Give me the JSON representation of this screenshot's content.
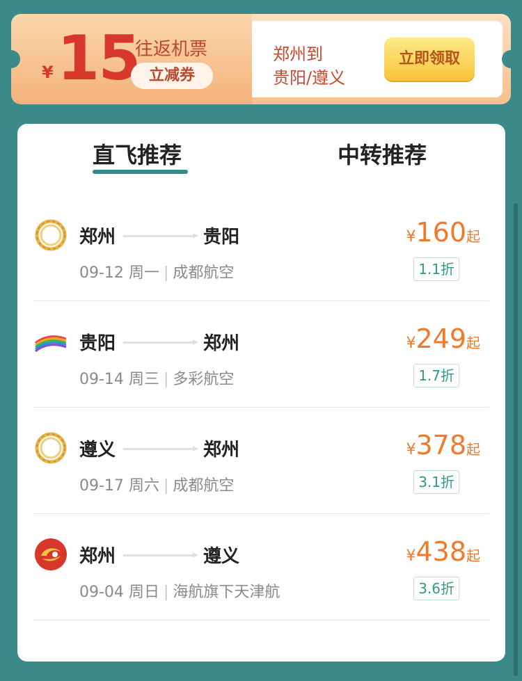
{
  "coupon": {
    "currency": "¥",
    "amount": "15",
    "title": "往返机票",
    "badge": "立减券",
    "route_line1": "郑州到",
    "route_line2": "贵阳/遵义",
    "claim_label": "立即领取"
  },
  "tabs": [
    {
      "label": "直飞推荐",
      "active": true
    },
    {
      "label": "中转推荐",
      "active": false
    }
  ],
  "flights": [
    {
      "logo": "sichuan-airlines-logo-icon",
      "from": "郑州",
      "to": "贵阳",
      "date": "09-12",
      "weekday": "周一",
      "airline": "成都航空",
      "currency": "¥",
      "price": "160",
      "suffix": "起",
      "discount": "1.1折"
    },
    {
      "logo": "colorful-guizhou-airlines-logo-icon",
      "from": "贵阳",
      "to": "郑州",
      "date": "09-14",
      "weekday": "周三",
      "airline": "多彩航空",
      "currency": "¥",
      "price": "249",
      "suffix": "起",
      "discount": "1.7折"
    },
    {
      "logo": "sichuan-airlines-logo-icon",
      "from": "遵义",
      "to": "郑州",
      "date": "09-17",
      "weekday": "周六",
      "airline": "成都航空",
      "currency": "¥",
      "price": "378",
      "suffix": "起",
      "discount": "3.1折"
    },
    {
      "logo": "tianjin-airlines-logo-icon",
      "from": "郑州",
      "to": "遵义",
      "date": "09-04",
      "weekday": "周日",
      "airline": "海航旗下天津航",
      "currency": "¥",
      "price": "438",
      "suffix": "起",
      "discount": "3.6折"
    }
  ],
  "colors": {
    "background": "#3b8a8a",
    "price": "#f07a2c",
    "coupon_red": "#d8382b",
    "tab_accent": "#2f8c8a"
  }
}
